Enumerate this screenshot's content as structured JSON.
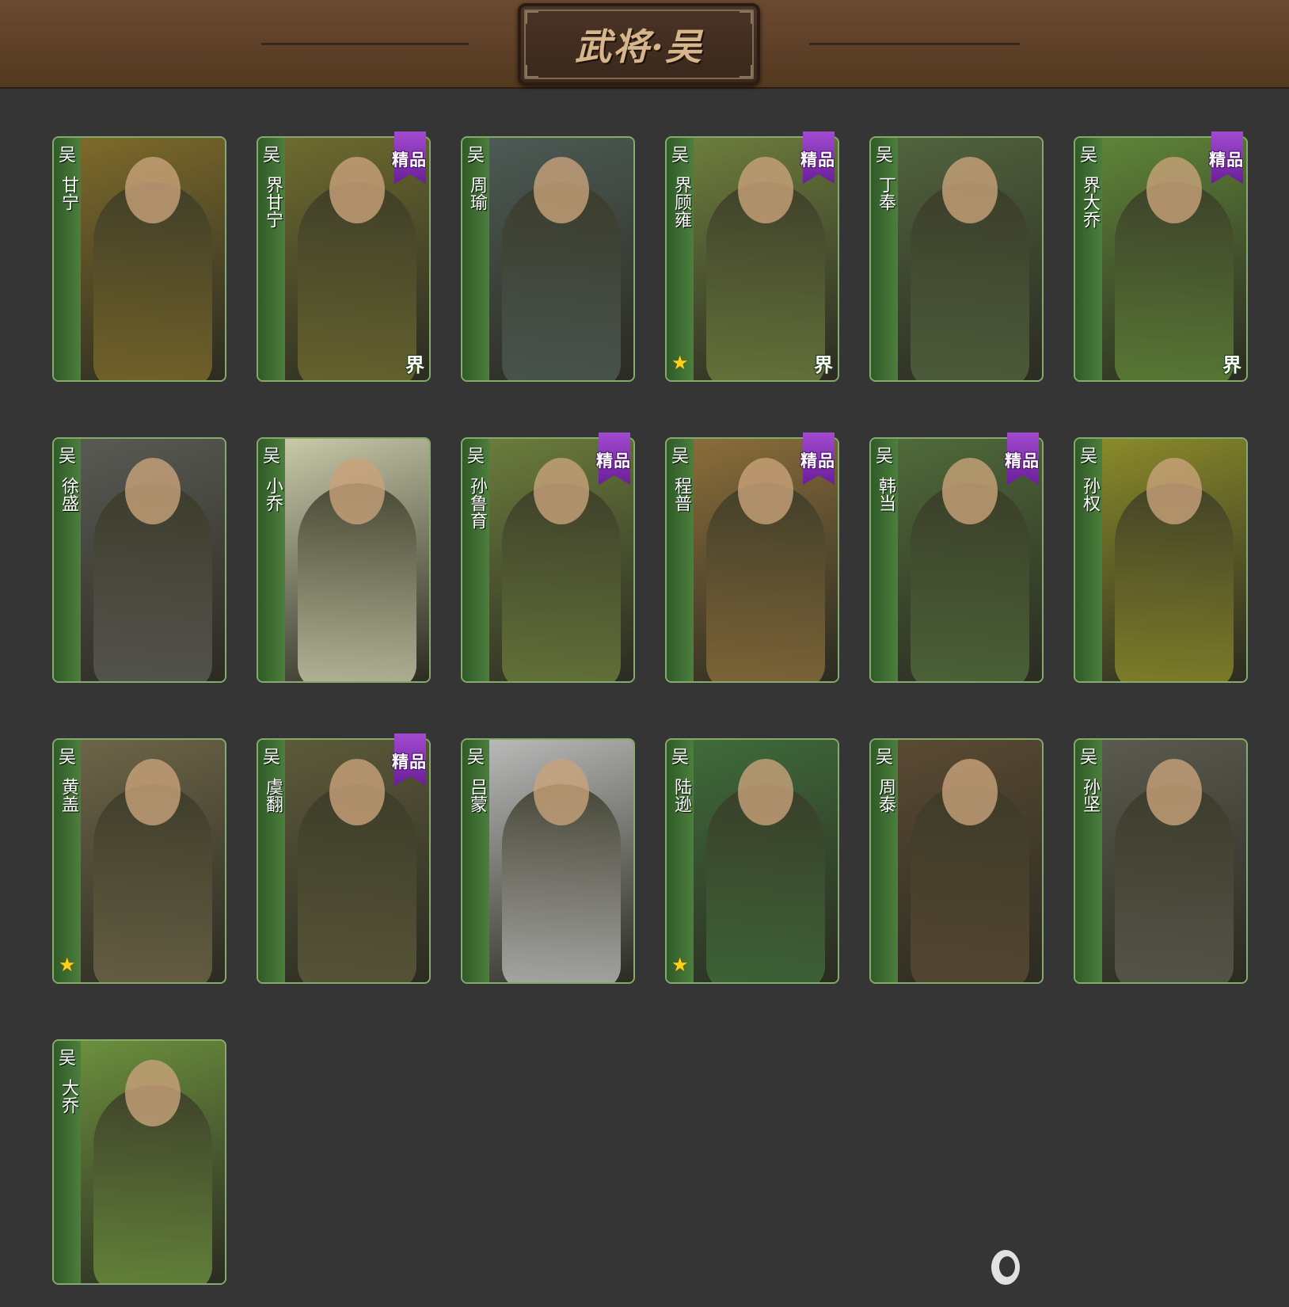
{
  "header": {
    "title": "武将·吴"
  },
  "colors": {
    "background": "#353535",
    "header": "#5d3f28",
    "card_green": "#3d6a34",
    "badge_purple": "#8a2fc0",
    "star_gold": "#ffd21a"
  },
  "labels": {
    "faction": "吴",
    "badge": "精品",
    "jie": "界",
    "star": "★"
  },
  "cards": [
    {
      "name": "甘宁",
      "badge": false,
      "jie": false,
      "star": false,
      "palette": "#7d6a2a"
    },
    {
      "name": "界甘宁",
      "badge": true,
      "jie": true,
      "star": false,
      "palette": "#6e6b2f"
    },
    {
      "name": "周瑜",
      "badge": false,
      "jie": false,
      "star": false,
      "palette": "#4d5a55"
    },
    {
      "name": "界顾雍",
      "badge": true,
      "jie": true,
      "star": true,
      "palette": "#6d7d3d"
    },
    {
      "name": "丁奉",
      "badge": false,
      "jie": false,
      "star": false,
      "palette": "#51633e"
    },
    {
      "name": "界大乔",
      "badge": true,
      "jie": true,
      "star": false,
      "palette": "#5f8438"
    },
    {
      "name": "徐盛",
      "badge": false,
      "jie": false,
      "star": false,
      "palette": "#5a5a55"
    },
    {
      "name": "小乔",
      "badge": false,
      "jie": false,
      "star": false,
      "palette": "#c8c9a8"
    },
    {
      "name": "孙鲁育",
      "badge": true,
      "jie": false,
      "star": false,
      "palette": "#6b7c3c"
    },
    {
      "name": "程普",
      "badge": true,
      "jie": false,
      "star": false,
      "palette": "#8a6d3a"
    },
    {
      "name": "韩当",
      "badge": true,
      "jie": false,
      "star": false,
      "palette": "#4f6a3a"
    },
    {
      "name": "孙权",
      "badge": false,
      "jie": false,
      "star": false,
      "palette": "#8a8a2a"
    },
    {
      "name": "黄盖",
      "badge": false,
      "jie": false,
      "star": true,
      "palette": "#6d6548"
    },
    {
      "name": "虞翻",
      "badge": true,
      "jie": false,
      "star": false,
      "palette": "#5d5a3a"
    },
    {
      "name": "吕蒙",
      "badge": false,
      "jie": false,
      "star": false,
      "palette": "#b9b9b9"
    },
    {
      "name": "陆逊",
      "badge": false,
      "jie": false,
      "star": true,
      "palette": "#3f6b3a"
    },
    {
      "name": "周泰",
      "badge": false,
      "jie": false,
      "star": false,
      "palette": "#5a4a33"
    },
    {
      "name": "孙坚",
      "badge": false,
      "jie": false,
      "star": false,
      "palette": "#5a5a4f"
    },
    {
      "name": "大乔",
      "badge": false,
      "jie": false,
      "star": false,
      "palette": "#6b8f3d"
    }
  ]
}
